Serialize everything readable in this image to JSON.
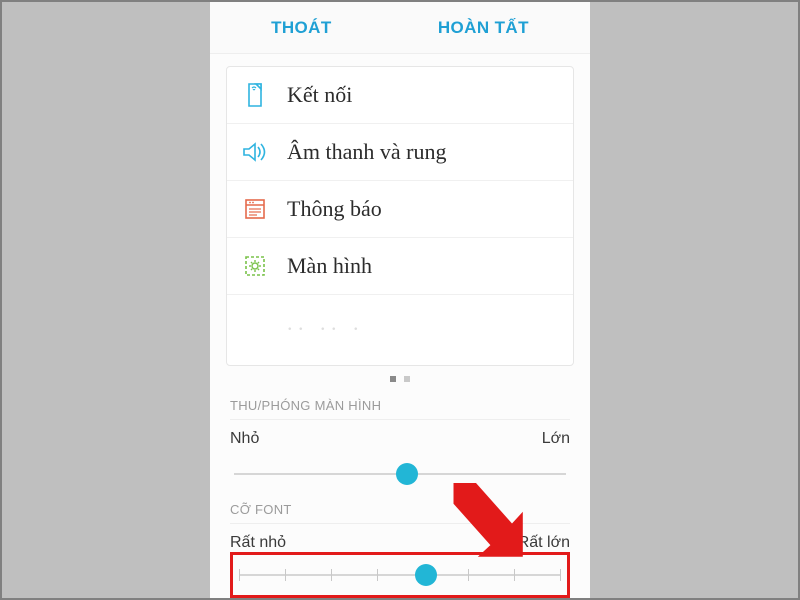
{
  "header": {
    "cancel": "THOÁT",
    "done": "HOÀN TẤT"
  },
  "preview": {
    "items": [
      {
        "id": "connections",
        "label": "Kết nối"
      },
      {
        "id": "sound",
        "label": "Âm thanh và rung"
      },
      {
        "id": "notifications",
        "label": "Thông báo"
      },
      {
        "id": "display",
        "label": "Màn hình"
      }
    ]
  },
  "zoom": {
    "title": "THU/PHÓNG MÀN HÌNH",
    "min_label": "Nhỏ",
    "max_label": "Lớn",
    "value_pct": 52
  },
  "font": {
    "title": "CỠ FONT",
    "min_label": "Rất nhỏ",
    "max_label": "Rất lớn",
    "ticks": 8,
    "value_pct": 58
  },
  "colors": {
    "accent": "#22b6d6",
    "link": "#1fa0d4",
    "highlight": "#e21a1a"
  }
}
